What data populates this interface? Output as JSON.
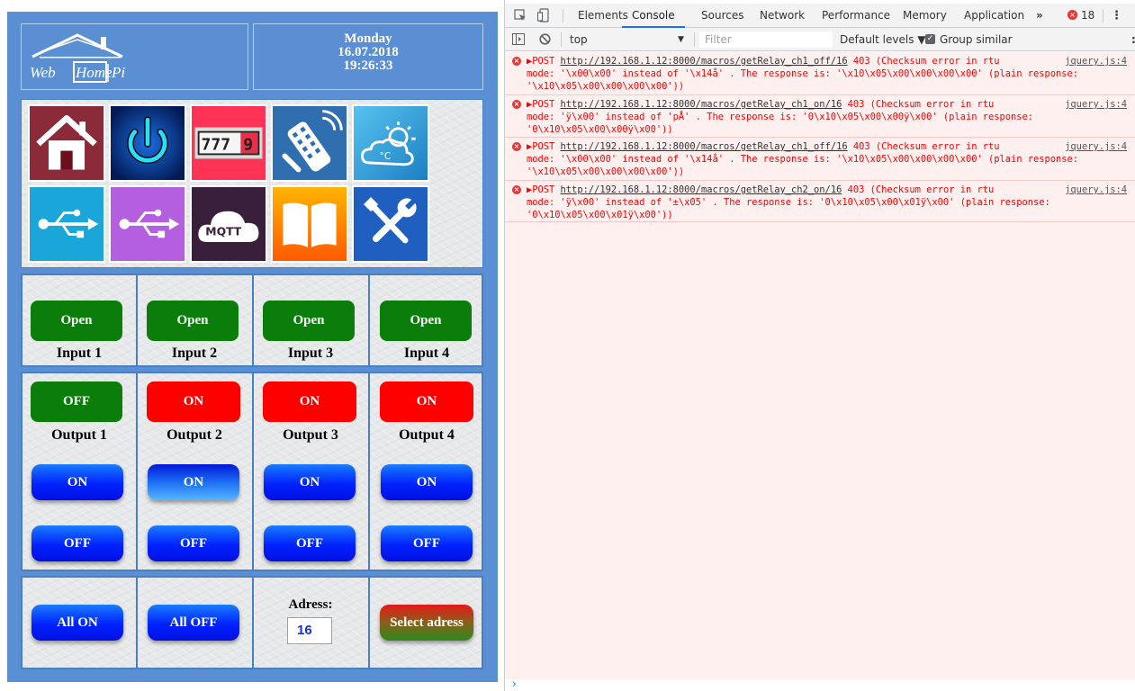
{
  "header": {
    "logo_text": "Web Home Pi",
    "day": "Monday",
    "date": "16.07.2018",
    "time": "19:26:33"
  },
  "tiles": [
    {
      "name": "home-icon",
      "color": "#8b2b3a"
    },
    {
      "name": "power-icon",
      "color": "#0a3fa8"
    },
    {
      "name": "counter-icon",
      "color": "#ff3355",
      "text": "7779"
    },
    {
      "name": "remote-control-icon",
      "color": "#2f74b5"
    },
    {
      "name": "weather-icon",
      "color": "#3aa4dd"
    },
    {
      "name": "usb-icon",
      "color": "#1aa6d8"
    },
    {
      "name": "usb-icon",
      "color": "#b45fe0"
    },
    {
      "name": "mqtt-icon",
      "color": "#3a1f3c",
      "text": "MQTT"
    },
    {
      "name": "book-icon",
      "color": "#ff8a00"
    },
    {
      "name": "tools-icon",
      "color": "#1f5fbf"
    }
  ],
  "inputs": [
    {
      "state": "Open",
      "label": "Input 1"
    },
    {
      "state": "Open",
      "label": "Input 2"
    },
    {
      "state": "Open",
      "label": "Input 3"
    },
    {
      "state": "Open",
      "label": "Input 4"
    }
  ],
  "outputs": [
    {
      "state": "OFF",
      "state_color": "#0b7d0b",
      "label": "Output 1",
      "on_label": "ON",
      "off_label": "OFF"
    },
    {
      "state": "ON",
      "state_color": "#ff0000",
      "label": "Output 2",
      "on_label": "ON",
      "off_label": "OFF"
    },
    {
      "state": "ON",
      "state_color": "#ff0000",
      "label": "Output 3",
      "on_label": "ON",
      "off_label": "OFF"
    },
    {
      "state": "ON",
      "state_color": "#ff0000",
      "label": "Output 4",
      "on_label": "ON",
      "off_label": "OFF"
    }
  ],
  "controls": {
    "all_on": "All ON",
    "all_off": "All OFF",
    "address_label": "Adress:",
    "address_value": "16",
    "select_address": "Select adress"
  },
  "devtools": {
    "tabs": [
      "Elements",
      "Console",
      "Sources",
      "Network",
      "Performance",
      "Memory",
      "Application"
    ],
    "more": "»",
    "active_tab": "Console",
    "error_count": "18",
    "context": "top",
    "filter_placeholder": "Filter",
    "levels": "Default levels ▼",
    "group_similar": "Group similar",
    "messages": [
      {
        "lines": [
          "▶POST ",
          "http://192.168.1.12:8000/macros/getRelay_ch1_off/16",
          " 403 (Checksum error in rtu",
          "mode: '\\x00\\x00' instead of '\\x14å' . The response is: '\\x10\\x05\\x00\\x00\\x00\\x00' (plain response:",
          "'\\x10\\x05\\x00\\x00\\x00\\x00'))"
        ],
        "source": "jquery.js:4"
      },
      {
        "lines": [
          "▶POST ",
          "http://192.168.1.12:8000/macros/getRelay_ch1_on/16",
          " 403 (Checksum error in rtu",
          "mode: 'ÿ\\x00' instead of 'pÅ' . The response is: '0\\x10\\x05\\x00\\x00ÿ\\x00' (plain response:",
          "'0\\x10\\x05\\x00\\x00ÿ\\x00'))"
        ],
        "source": "jquery.js:4"
      },
      {
        "lines": [
          "▶POST ",
          "http://192.168.1.12:8000/macros/getRelay_ch1_off/16",
          " 403 (Checksum error in rtu",
          "mode: '\\x00\\x00' instead of '\\x14å' . The response is: '\\x10\\x05\\x00\\x00\\x00\\x00' (plain response:",
          "'\\x10\\x05\\x00\\x00\\x00\\x00'))"
        ],
        "source": "jquery.js:4"
      },
      {
        "lines": [
          "▶POST ",
          "http://192.168.1.12:8000/macros/getRelay_ch2_on/16",
          " 403 (Checksum error in rtu",
          "mode: 'ÿ\\x00' instead of '±\\x05' . The response is: '0\\x10\\x05\\x00\\x01ÿ\\x00' (plain response:",
          "'0\\x10\\x05\\x00\\x01ÿ\\x00'))"
        ],
        "source": "jquery.js:4"
      }
    ],
    "prompt": "›"
  }
}
